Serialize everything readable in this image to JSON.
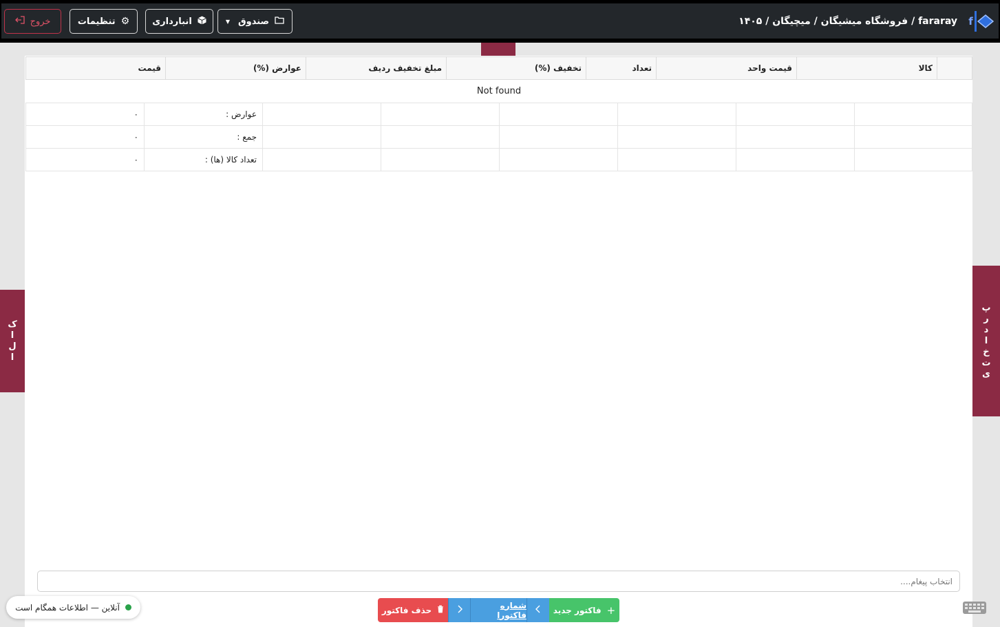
{
  "header": {
    "brand_letter": "f",
    "breadcrumb": "fararay / فروشگاه میشیگان / میچیگان / ۱۴۰۵",
    "buttons": {
      "exit": "خروج",
      "settings": "تنظیمات",
      "warehouse": "انبارداری",
      "cash": "صندوق"
    }
  },
  "table": {
    "columns": [
      "کالا",
      "قیمت واحد",
      "تعداد",
      "تخفیف (%)",
      "مبلغ تخفیف ردیف",
      "عوارض (%)",
      "قیمت"
    ],
    "empty_text": "Not found"
  },
  "summary": {
    "rows": [
      {
        "label": "عوارض :",
        "value": "۰"
      },
      {
        "label": "جمع :",
        "value": "۰"
      },
      {
        "label": "تعداد کالا (ها) :",
        "value": "۰"
      }
    ]
  },
  "message": {
    "placeholder": "انتخاب پیغام...."
  },
  "actions": {
    "delete": "حذف فاکتور",
    "invoice_number": "شماره فاکتورا",
    "new": "فاکتور جدید"
  },
  "side_tabs": {
    "left_letters": [
      "ک",
      "ا",
      "ل",
      "ا"
    ],
    "right_letters": [
      "پ",
      "ر",
      "د",
      "ا",
      "خ",
      "ت",
      "ی"
    ]
  },
  "status": {
    "text": "آنلاین — اطلاعات همگام است"
  },
  "colors": {
    "accent": "#8b2a44",
    "topbar": "#23272b",
    "delete": "#e84c4f",
    "nav": "#4a9fe0",
    "new": "#47c46a",
    "online": "#2aa24a"
  }
}
